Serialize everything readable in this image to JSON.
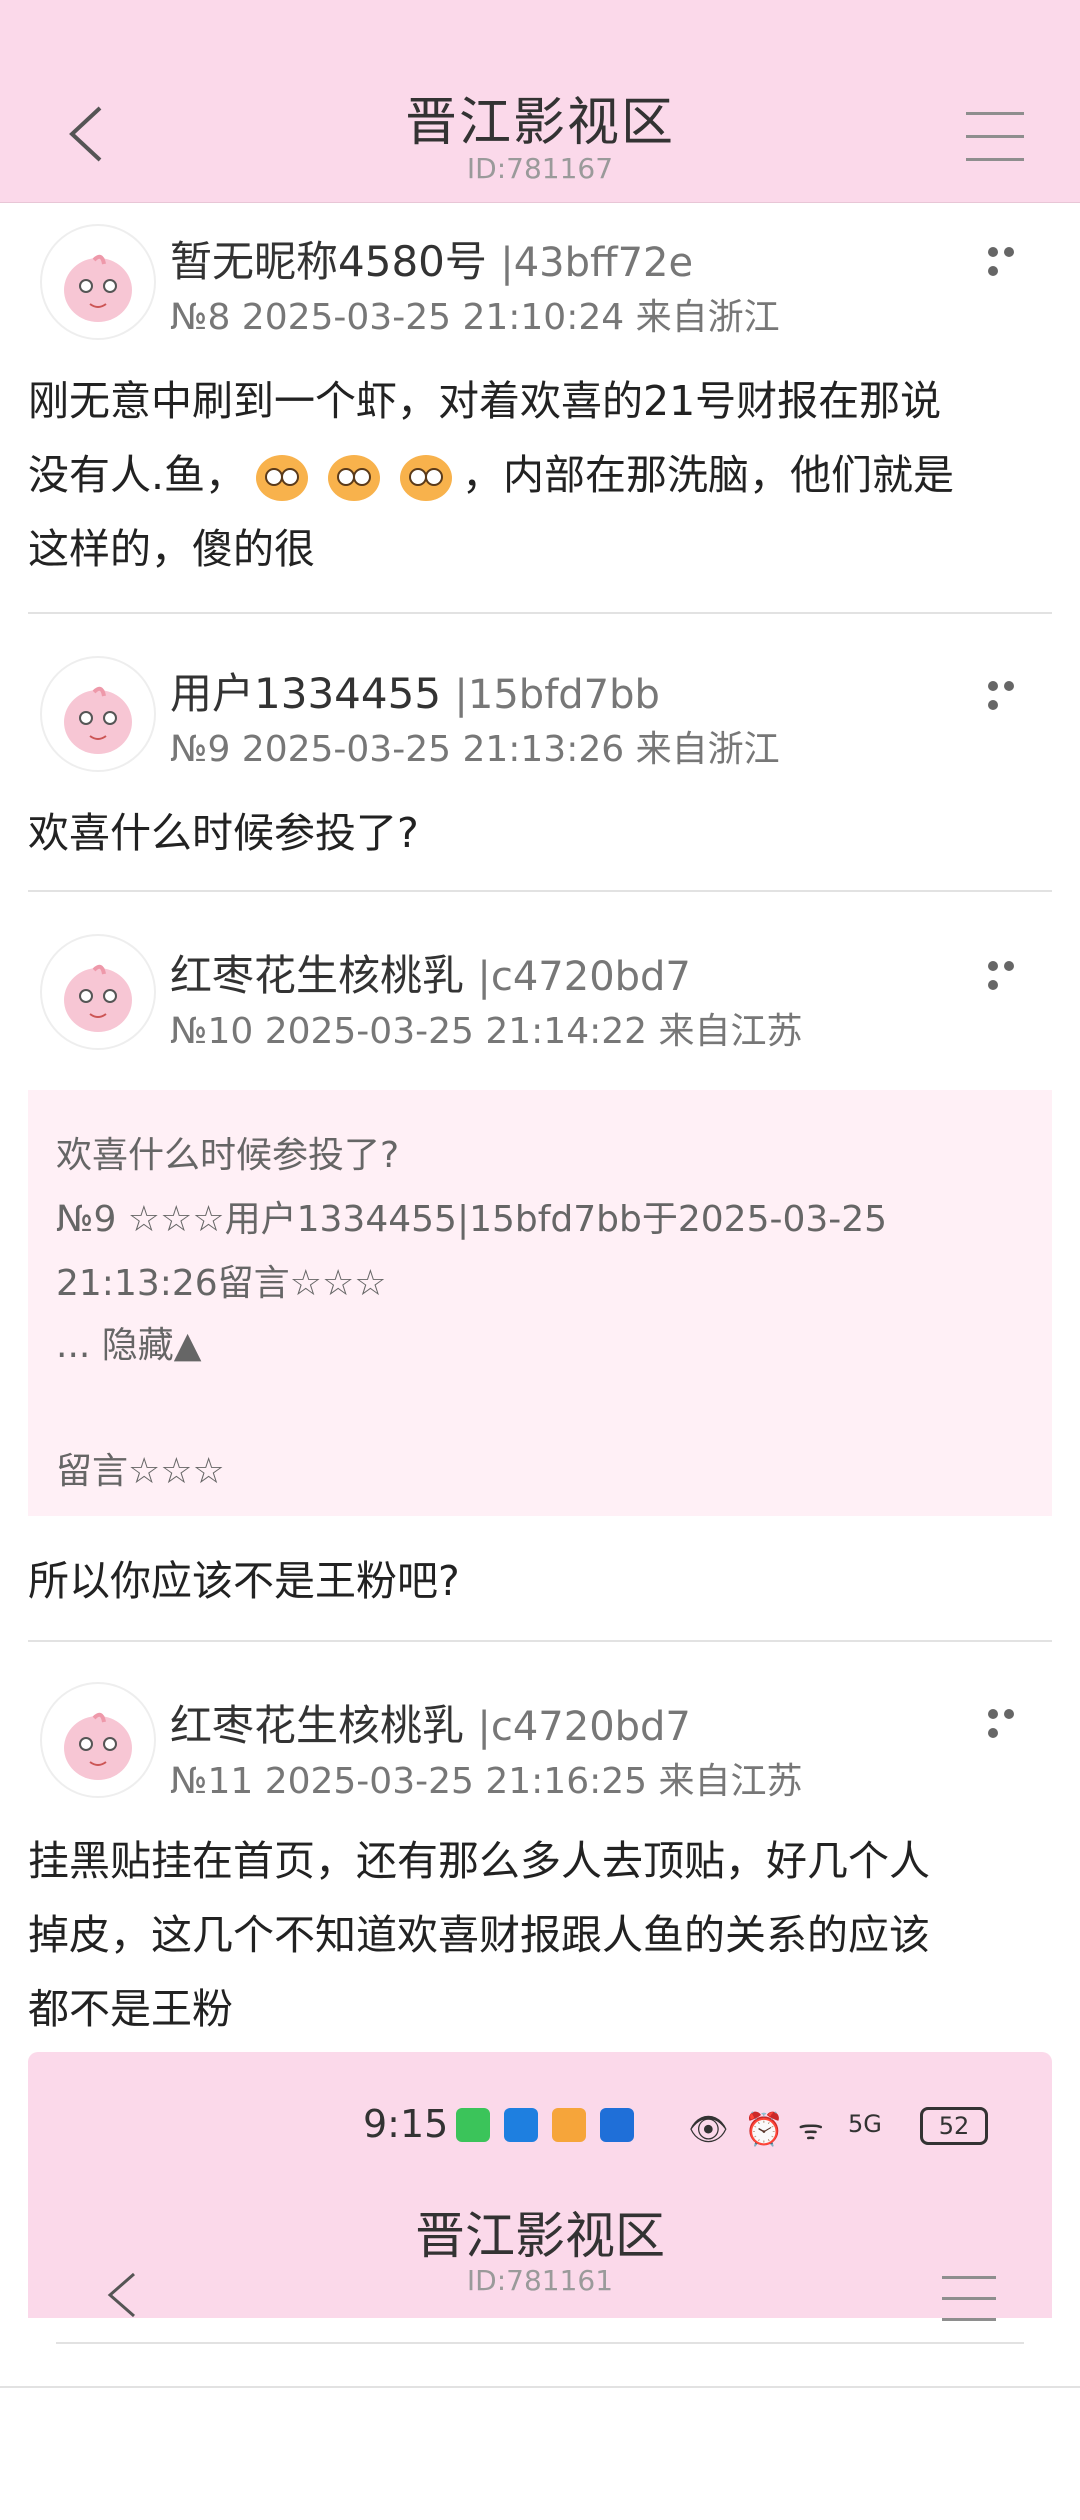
{
  "header": {
    "title": "晋江影视区",
    "subtitle": "ID:781167"
  },
  "posts": [
    {
      "username": "暂无昵称4580号",
      "hash": "|43bff72e",
      "meta": "№8 2025-03-25 21:10:24 来自浙江",
      "body_lines": [
        "刚无意中刷到一个虾，对着欢喜的21号财报在那说",
        "，内部在那洗脑，他们就是",
        "这样的，傻的很"
      ],
      "body_prefix2": "没有人.鱼，"
    },
    {
      "username": "用户1334455",
      "hash": "|15bfd7bb",
      "meta": "№9 2025-03-25 21:13:26 来自浙江",
      "body": "欢喜什么时候参投了?"
    },
    {
      "username": "红枣花生核桃乳",
      "hash": "|c4720bd7",
      "meta": "№10 2025-03-25 21:14:22 来自江苏",
      "quote": [
        "欢喜什么时候参投了?",
        "№9 ☆☆☆用户1334455|15bfd7bb于2025-03-25",
        "21:13:26留言☆☆☆",
        "... 隐藏▲",
        "留言☆☆☆"
      ],
      "body": "所以你应该不是王粉吧?"
    },
    {
      "username": "红枣花生核桃乳",
      "hash": "|c4720bd7",
      "meta": "№11 2025-03-25 21:16:25 来自江苏",
      "body_lines": [
        "挂黑贴挂在首页，还有那么多人去顶贴，好几个人",
        "掉皮，这几个不知道欢喜财报跟人鱼的关系的应该",
        "都不是王粉"
      ]
    }
  ],
  "embedded_screenshot": {
    "time": "9:15",
    "signal": "5G",
    "battery": "52",
    "title": "晋江影视区",
    "subtitle": "ID:781161"
  },
  "colors": {
    "header_bg": "#fbd9ea",
    "quote_bg": "#fff0f6"
  }
}
